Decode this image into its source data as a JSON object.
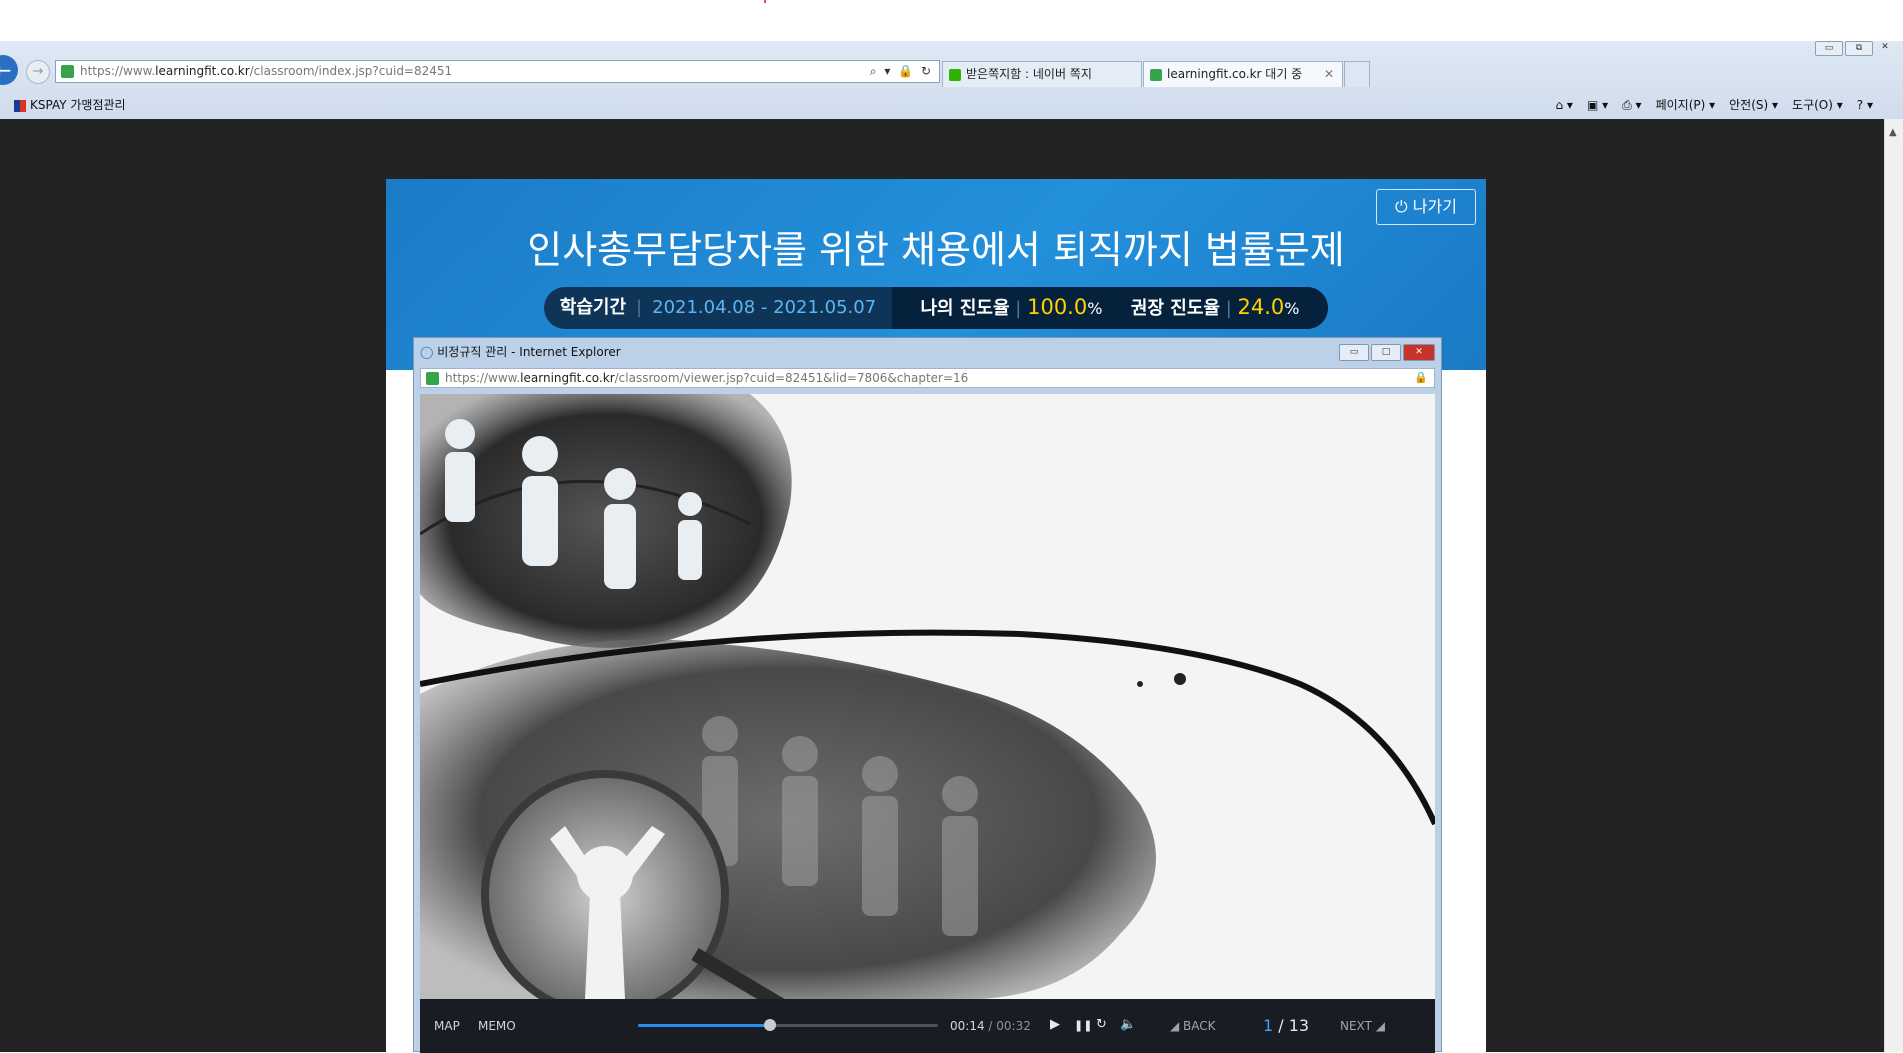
{
  "browser": {
    "window_buttons": [
      "▭",
      "⧉",
      "✕"
    ],
    "url_scheme": "https://www.",
    "url_domain": "learningfit.co.kr",
    "url_path": "/classroom/index.jsp?cuid=82451",
    "addr_tools": "⌕ ▾ 🔒 ↻",
    "tabs": [
      {
        "label": "받은쪽지함 : 네이버 쪽지"
      },
      {
        "label": "learningfit.co.kr 대기 중"
      }
    ],
    "tab_close": "✕",
    "favorites": [
      {
        "label": "KSPAY 가맹점관리"
      }
    ],
    "command_bar": [
      "페이지(P) ▾",
      "안전(S) ▾",
      "도구(O) ▾"
    ]
  },
  "course": {
    "exit_label": "⏻ 나가기",
    "title": "인사총무담당자를 위한 채용에서 퇴직까지 법률문제",
    "period_label": "학습기간",
    "period_value": "2021.04.08 - 2021.05.07",
    "my_progress_label": "나의 진도율",
    "my_progress_value": "100.0",
    "recommended_label": "권장 진도율",
    "recommended_value": "24.0",
    "percent_sign": "%"
  },
  "popup": {
    "title": "비정규직 관리 - Internet Explorer",
    "url_scheme": "https://www.",
    "url_domain": "learningfit.co.kr",
    "url_path": "/classroom/viewer.jsp?cuid=82451&lid=7806&chapter=16",
    "buttons": [
      "▭",
      "□",
      "✕"
    ]
  },
  "player": {
    "map_label": "MAP",
    "memo_label": "MEMO",
    "current_time": "00:14",
    "time_sep": " / ",
    "duration": "00:32",
    "progress_fraction": 0.44,
    "back_label": "◢ BACK",
    "page_current": "1",
    "page_sep": " / ",
    "page_total": "13",
    "next_label": "NEXT ◢",
    "icons": {
      "play": "▶",
      "pause": "❚❚",
      "replay": "↻",
      "volume": "🔈"
    }
  },
  "colors": {
    "banner": "#1b7cc8",
    "highlight": "#ffd200",
    "accent": "#3fa2ff"
  }
}
